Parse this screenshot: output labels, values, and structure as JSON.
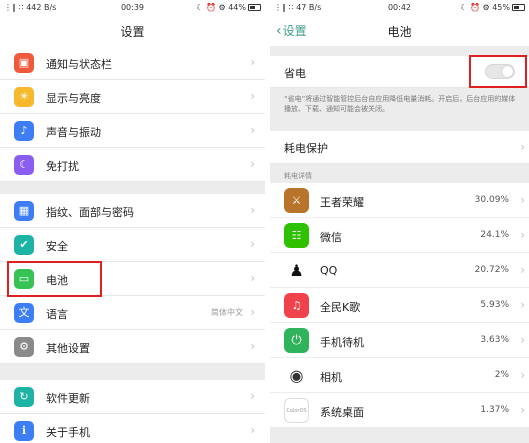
{
  "left": {
    "status": {
      "signal": "⋮∥ ∷",
      "speed": "442 B/s",
      "time": "00:39",
      "icons": "☾ ⏰ ⚙",
      "battery": "44%"
    },
    "title": "设置",
    "items": [
      {
        "label": "通知与状态栏",
        "color": "#f05a3c",
        "glyph": "▣"
      },
      {
        "label": "显示与亮度",
        "color": "#f5b92b",
        "glyph": "☀"
      },
      {
        "label": "声音与振动",
        "color": "#3e7ef4",
        "glyph": "♪"
      },
      {
        "label": "免打扰",
        "color": "#8a5cf0",
        "glyph": "☾"
      },
      {
        "label": "指纹、面部与密码",
        "color": "#3e7ef4",
        "glyph": "▦"
      },
      {
        "label": "安全",
        "color": "#1db3a5",
        "glyph": "✔"
      },
      {
        "label": "电池",
        "color": "#36c254",
        "glyph": "▭"
      },
      {
        "label": "语言",
        "color": "#3e7ef4",
        "glyph": "文",
        "value": "简体中文"
      },
      {
        "label": "其他设置",
        "color": "#8a8a8a",
        "glyph": "⚙"
      },
      {
        "label": "软件更新",
        "color": "#1db3a5",
        "glyph": "↻"
      },
      {
        "label": "关于手机",
        "color": "#3e7ef4",
        "glyph": "ℹ"
      }
    ],
    "chevron": "›"
  },
  "right": {
    "status": {
      "signal": "⋮∥ ∷",
      "speed": "47 B/s",
      "time": "00:42",
      "icons": "☾ ⏰ ⚙",
      "battery": "45%"
    },
    "back_label": "设置",
    "title": "电池",
    "power_saving": {
      "label": "省电",
      "enabled": false
    },
    "description": "“省电”将通过智能管控后台自应用降低电量消耗。开启后，后台应用的媒体播放、下载、通知可能会被关闭。",
    "protection_label": "耗电保护",
    "details_header": "耗电详情",
    "apps": [
      {
        "name": "王者荣耀",
        "percent": "30.09%",
        "color": "#b8742a",
        "glyph": "⚔"
      },
      {
        "name": "微信",
        "percent": "24.1%",
        "color": "#2dc100",
        "glyph": "☷"
      },
      {
        "name": "QQ",
        "percent": "20.72%",
        "color": "#ffffff",
        "glyph": "♟"
      },
      {
        "name": "全民K歌",
        "percent": "5.93%",
        "color": "#f0424a",
        "glyph": "♫"
      },
      {
        "name": "手机待机",
        "percent": "3.63%",
        "color": "#2fb45c",
        "glyph": "⏻"
      },
      {
        "name": "相机",
        "percent": "2%",
        "color": "#ffffff",
        "glyph": "◉"
      },
      {
        "name": "系统桌面",
        "percent": "1.37%",
        "color": "#ffffff",
        "glyph": "ColorOS"
      }
    ],
    "chevron": "›"
  },
  "highlight_color": "#e02020"
}
